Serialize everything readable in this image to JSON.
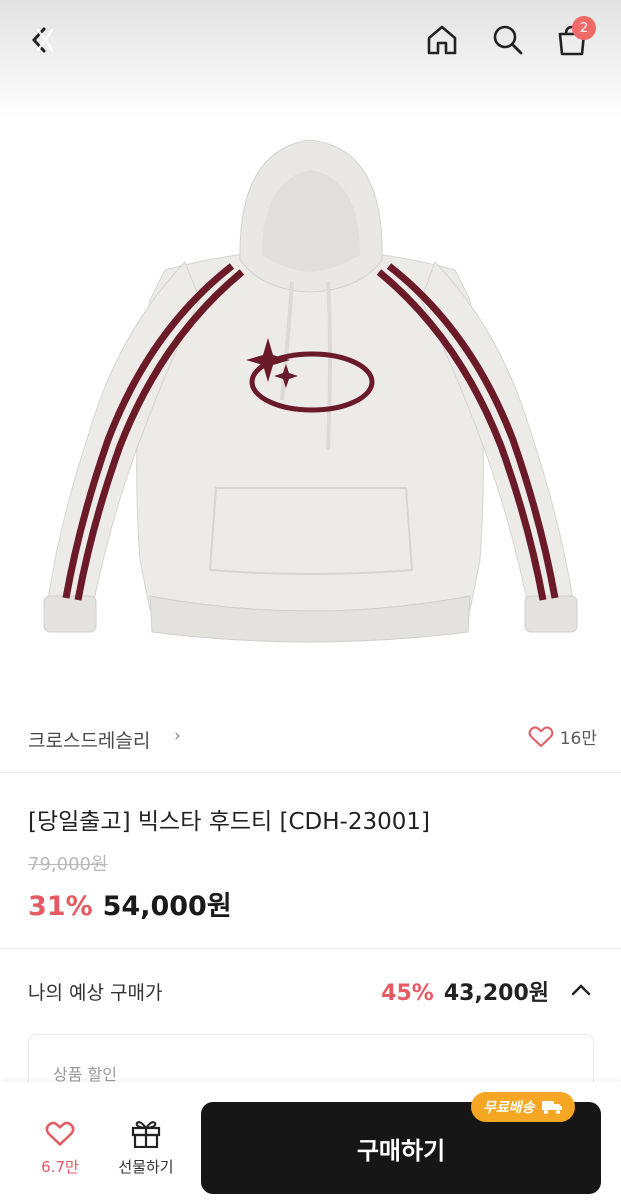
{
  "header": {
    "back_icon": "back-arrow-icon",
    "home_icon": "home-icon",
    "search_icon": "search-icon",
    "cart_icon": "shopping-bag-icon",
    "cart_count": "2"
  },
  "brand": {
    "name": "크로스드레슬리",
    "chevron": "›",
    "like_count": "16만"
  },
  "product": {
    "title": "[당일출고] 빅스타 후드티 [CDH-23001]",
    "original_price": "79,000원",
    "discount_rate": "31%",
    "price": "54,000원"
  },
  "expected": {
    "label": "나의 예상 구매가",
    "discount_rate": "45%",
    "price": "43,200원"
  },
  "discount_detail": {
    "label": "상품 할인"
  },
  "bottom": {
    "like_count": "6.7만",
    "gift_label": "선물하기",
    "buy_label": "구매하기",
    "free_shipping_label": "무료배송"
  },
  "colors": {
    "accent_red": "#e55b63",
    "buy_button": "#161616",
    "free_shipping_badge": "#f5a623",
    "stripe_maroon": "#6b1a2a"
  }
}
